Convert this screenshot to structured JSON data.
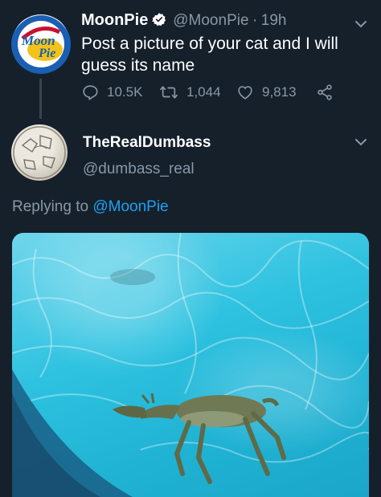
{
  "original_tweet": {
    "display_name": "MoonPie",
    "handle": "@MoonPie",
    "separator": "·",
    "time": "19h",
    "text": "Post a picture of your cat and I will guess its name",
    "avatar_logo_text": "Moon Pie",
    "stats": {
      "replies": "10.5K",
      "retweets": "1,044",
      "likes": "9,813"
    }
  },
  "reply_tweet": {
    "display_name": "TheRealDumbass",
    "handle": "@dumbass_real",
    "replying_prefix": "Replying to",
    "replying_to": "@MoonPie"
  },
  "media": {
    "subject": "deer floating in swimming pool"
  },
  "icons": {
    "verified": "verified-badge-icon",
    "chevron": "chevron-down-icon",
    "reply": "reply-icon",
    "retweet": "retweet-icon",
    "like": "heart-icon",
    "share": "share-icon"
  },
  "colors": {
    "background": "#15202b",
    "text": "#ffffff",
    "secondary_text": "#8899a6",
    "accent": "#1da1f2",
    "pool_water": "#2ec2e0"
  }
}
